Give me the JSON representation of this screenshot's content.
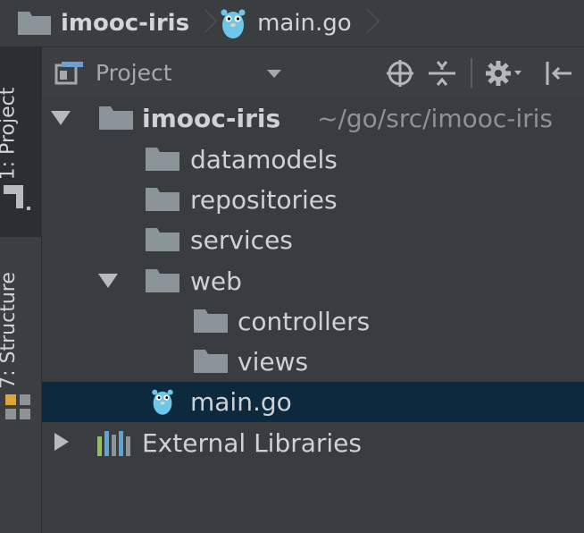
{
  "breadcrumb": {
    "project": "imooc-iris",
    "file": "main.go"
  },
  "toolstrip": {
    "project_tab": "1: Project",
    "structure_tab": "7: Structure"
  },
  "panel": {
    "view_label": "Project"
  },
  "tree": {
    "root": {
      "name": "imooc-iris",
      "path": "~/go/src/imooc-iris"
    },
    "items": [
      {
        "name": "datamodels"
      },
      {
        "name": "repositories"
      },
      {
        "name": "services"
      },
      {
        "name": "web"
      },
      {
        "name": "controllers"
      },
      {
        "name": "views"
      },
      {
        "name": "main.go"
      },
      {
        "name": "External Libraries"
      }
    ]
  },
  "colors": {
    "background": "#3a3d3f",
    "selection": "#0d293e",
    "folder": "#8a9499",
    "gopher": "#6ec6e8"
  }
}
